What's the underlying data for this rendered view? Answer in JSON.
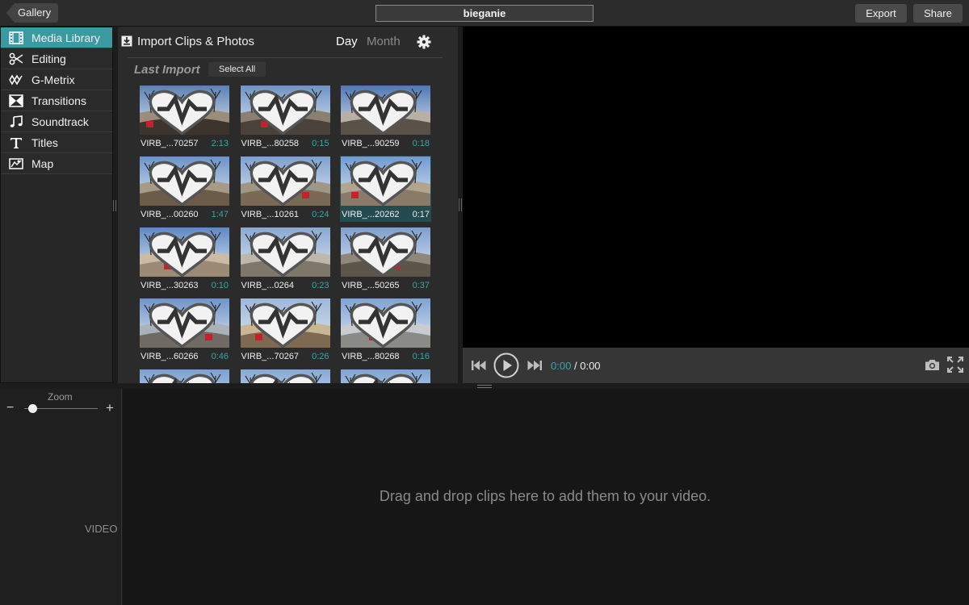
{
  "topbar": {
    "back_label": "Gallery",
    "project_title": "bieganie",
    "export_label": "Export",
    "share_label": "Share"
  },
  "sidebar": {
    "items": [
      {
        "label": "Media Library",
        "icon": "film-strip-icon",
        "active": true
      },
      {
        "label": "Editing",
        "icon": "scissors-icon",
        "active": false
      },
      {
        "label": "G-Metrix",
        "icon": "g-metrix-icon",
        "active": false
      },
      {
        "label": "Transitions",
        "icon": "transitions-icon",
        "active": false
      },
      {
        "label": "Soundtrack",
        "icon": "music-note-icon",
        "active": false
      },
      {
        "label": "Titles",
        "icon": "titles-icon",
        "active": false
      },
      {
        "label": "Map",
        "icon": "map-icon",
        "active": false
      }
    ],
    "accent_color": "#3a9aa2"
  },
  "library": {
    "import_label": "Import Clips & Photos",
    "tabs": {
      "day": "Day",
      "month": "Month"
    },
    "section_title": "Last Import",
    "select_all_label": "Select All",
    "clips": [
      {
        "name": "VIRB_...70257",
        "duration": "2:13",
        "selected": false
      },
      {
        "name": "VIRB_...80258",
        "duration": "0:15",
        "selected": false
      },
      {
        "name": "VIRB_...90259",
        "duration": "0:18",
        "selected": false
      },
      {
        "name": "VIRB_...00260",
        "duration": "1:47",
        "selected": false
      },
      {
        "name": "VIRB_...10261",
        "duration": "0:24",
        "selected": false
      },
      {
        "name": "VIRB_...20262",
        "duration": "0:17",
        "selected": true
      },
      {
        "name": "VIRB_...30263",
        "duration": "0:10",
        "selected": false
      },
      {
        "name": "VIRB_...0264",
        "duration": "0:23",
        "selected": false
      },
      {
        "name": "VIRB_...50265",
        "duration": "0:37",
        "selected": false
      },
      {
        "name": "VIRB_...60266",
        "duration": "0:46",
        "selected": false
      },
      {
        "name": "VIRB_...70267",
        "duration": "0:26",
        "selected": false
      },
      {
        "name": "VIRB_...80268",
        "duration": "0:16",
        "selected": false
      },
      {
        "name": "",
        "duration": "",
        "selected": false
      },
      {
        "name": "",
        "duration": "",
        "selected": false
      },
      {
        "name": "",
        "duration": "",
        "selected": false
      }
    ],
    "duration_color": "#38a6ad"
  },
  "player": {
    "current_time": "0:00",
    "total_time": "/ 0:00"
  },
  "timeline": {
    "zoom_label": "Zoom",
    "zoom_minus": "−",
    "zoom_plus": "+",
    "zoom_level": 0.05,
    "video_track_label": "VIDEO",
    "drop_hint": "Drag and drop clips here to add them to your video."
  }
}
